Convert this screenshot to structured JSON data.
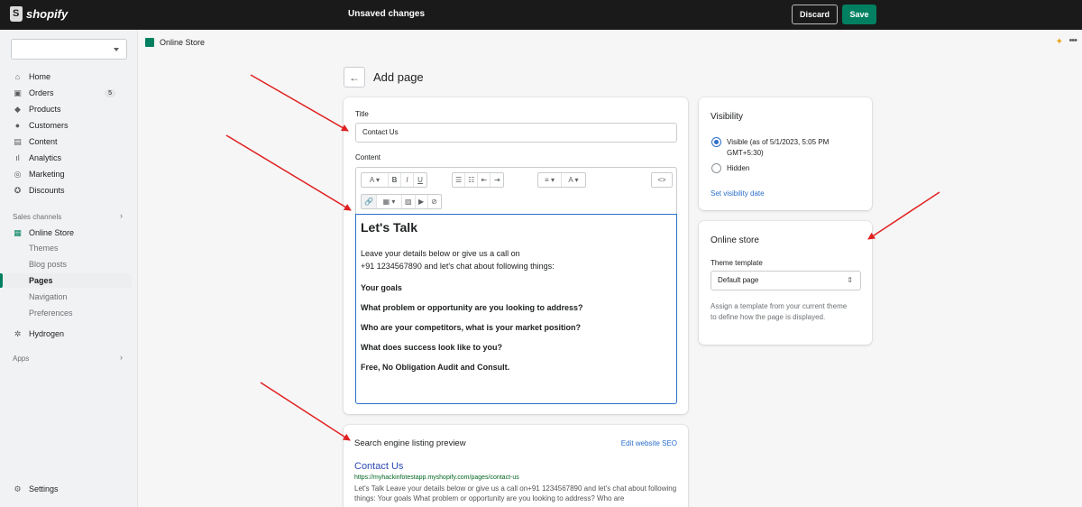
{
  "topbar": {
    "logo_text": "shopify",
    "status": "Unsaved changes",
    "discard_label": "Discard",
    "save_label": "Save"
  },
  "sidebar": {
    "items": [
      {
        "label": "Home",
        "icon": "home-icon"
      },
      {
        "label": "Orders",
        "icon": "orders-icon",
        "badge": "5"
      },
      {
        "label": "Products",
        "icon": "tag-icon"
      },
      {
        "label": "Customers",
        "icon": "person-icon"
      },
      {
        "label": "Content",
        "icon": "content-icon"
      },
      {
        "label": "Analytics",
        "icon": "bar-chart-icon"
      },
      {
        "label": "Marketing",
        "icon": "target-icon"
      },
      {
        "label": "Discounts",
        "icon": "discount-icon"
      }
    ],
    "sales_channels_label": "Sales channels",
    "online_store_label": "Online Store",
    "sub_items": [
      "Themes",
      "Blog posts",
      "Pages",
      "Navigation",
      "Preferences"
    ],
    "hydrogen_label": "Hydrogen",
    "apps_label": "Apps",
    "settings_label": "Settings"
  },
  "breadcrumb": {
    "label": "Online Store"
  },
  "page": {
    "title": "Add page"
  },
  "form": {
    "title_label": "Title",
    "title_value": "Contact Us",
    "content_label": "Content",
    "editor": {
      "heading": "Let's Talk",
      "intro_line1": "Leave your details below or give us a call on",
      "intro_line2": "+91 1234567890 and let's chat about following things:",
      "goals": "Your goals",
      "q1": "What problem or opportunity are you looking to address?",
      "q2": "Who are your competitors, what is your market position?",
      "q3": "What does success look like to you?",
      "offer": "Free, No Obligation Audit and Consult."
    }
  },
  "seo": {
    "heading": "Search engine listing preview",
    "edit_link": "Edit website SEO",
    "preview_title": "Contact Us",
    "preview_url": "https://myhackinfotestapp.myshopify.com/pages/contact-us",
    "preview_desc": "Let's Talk Leave your details below or give us a call on+91 1234567890 and let's chat about following things: Your goals What problem or opportunity are you looking to address? Who are"
  },
  "visibility": {
    "heading": "Visibility",
    "visible_label": "Visible (as of 5/1/2023, 5:05 PM GMT+5:30)",
    "hidden_label": "Hidden",
    "set_date_link": "Set visibility date"
  },
  "online_store": {
    "heading": "Online store",
    "template_label": "Theme template",
    "template_value": "Default page",
    "help_text": "Assign a template from your current theme to define how the page is displayed."
  },
  "annotation_color": "#e02020"
}
